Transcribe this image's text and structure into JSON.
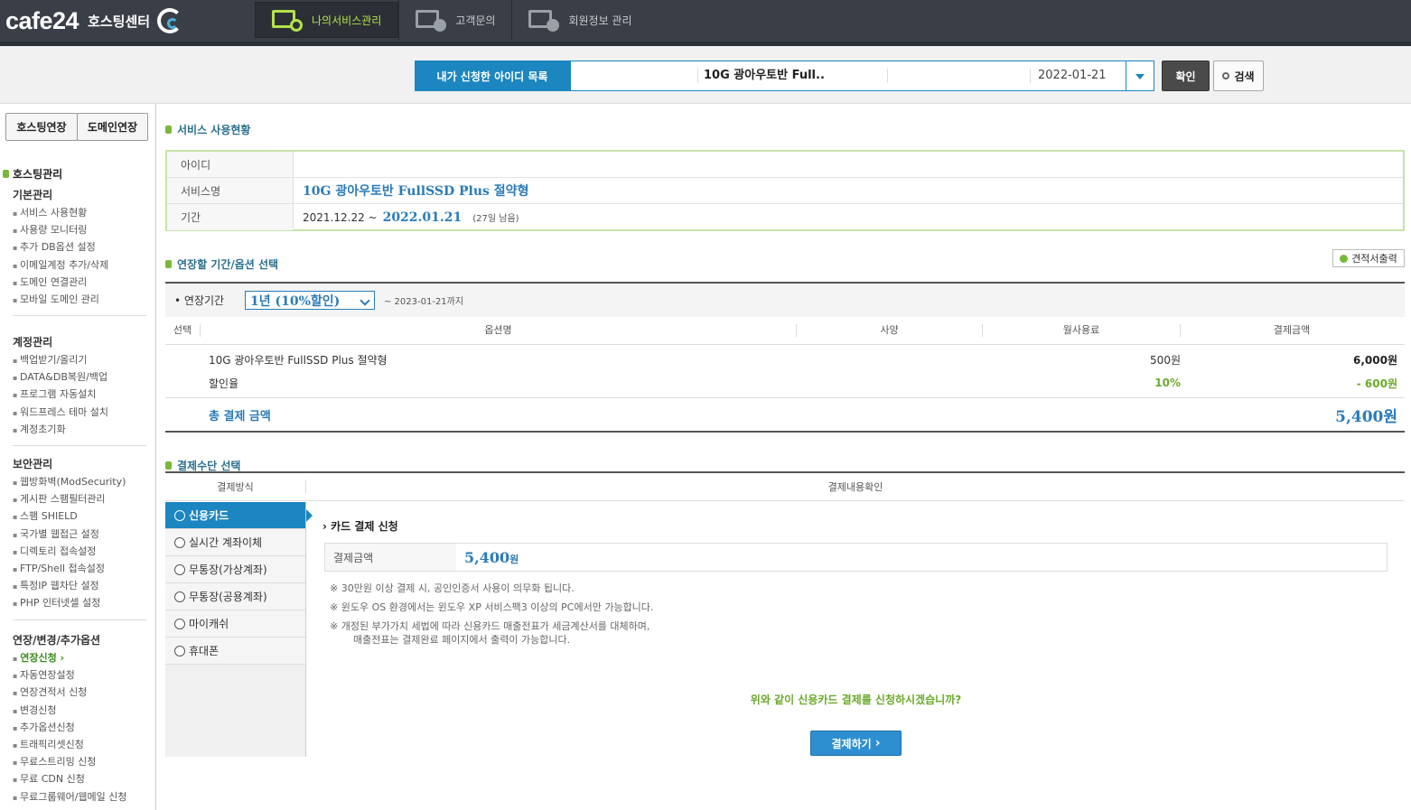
{
  "header": {
    "brand": "cafe24",
    "brand_sub": "호스팅센터",
    "nav": [
      {
        "label": "나의서비스관리",
        "icon": "monitor-gear-icon",
        "active": true
      },
      {
        "label": "고객문의",
        "icon": "monitor-chat-icon",
        "active": false
      },
      {
        "label": "회원정보 관리",
        "icon": "monitor-user-icon",
        "active": false
      }
    ]
  },
  "idbar": {
    "list_label": "내가 신청한 아이디 목록",
    "selected_service": "10G 광아우토반 Full..",
    "selected_date": "2022-01-21",
    "confirm_label": "확인",
    "search_label": "검색"
  },
  "sidebar": {
    "tab_hosting": "호스팅연장",
    "tab_domain": "도메인연장",
    "section_title": "호스팅관리",
    "groups": [
      {
        "title": "기본관리",
        "items": [
          "서비스 사용현황",
          "사용량 모니터링",
          "추가 DB옵션 설정",
          "이메일계정 추가/삭제",
          "도메인 연결관리",
          "모바일 도메인 관리"
        ]
      },
      {
        "title": "계정관리",
        "items": [
          "백업받기/올리기",
          "DATA&DB복원/백업",
          "프로그램 자동설치",
          "워드프레스 테마 설치",
          "계정초기화"
        ]
      },
      {
        "title": "보안관리",
        "items": [
          "웹방화벽(ModSecurity)",
          "게시판 스팸필터관리",
          "스팸 SHIELD",
          "국가별 웹접근 설정",
          "디렉토리 접속설정",
          "FTP/Shell 접속설정",
          "특정IP 웹차단 설정",
          "PHP 인터넷셀 설정"
        ]
      },
      {
        "title": "연장/변경/추가옵션",
        "items": [
          "연장신청",
          "자동연장설정",
          "연장견적서 신청",
          "변경신청",
          "추가옵션신청",
          "트래픽리셋신청",
          "무료스트리밍 신청",
          "무료 CDN 신청",
          "무료그룹웨어/웹메일 신청"
        ]
      }
    ]
  },
  "usage": {
    "title": "서비스 사용현황",
    "id_label": "아이디",
    "id_value": "",
    "service_label": "서비스명",
    "service_value": "10G 광아우토반 FullSSD Plus 절약형",
    "period_label": "기간",
    "period_start": "2021.12.22 ~",
    "period_end": "2022.01.21",
    "period_remain": "(27일 남음)"
  },
  "extend": {
    "title": "연장할 기간/옵션 선택",
    "quote_label": "견적서출력",
    "period_label": "연장기간",
    "period_select": "1년 (10%할인)",
    "period_until": "~ 2023-01-21까지",
    "columns": [
      "선택",
      "옵션명",
      "사양",
      "월사용료",
      "결제금액"
    ],
    "rows": [
      {
        "name": "10G 광아우토반 FullSSD Plus 절약형",
        "monthly": "500원",
        "amount": "6,000원"
      },
      {
        "name": "할인율",
        "monthly": "10%",
        "amount": "- 600원"
      }
    ],
    "total_label": "총 결제 금액",
    "total_value": "5,400원"
  },
  "payment": {
    "title": "결제수단 선택",
    "col_method": "결제방식",
    "col_confirm": "결제내용확인",
    "methods": [
      "신용카드",
      "실시간 계좌이체",
      "무통장(가상계좌)",
      "무통장(공용계좌)",
      "마이캐쉬",
      "휴대폰"
    ],
    "card_title": "카드 결제 신청",
    "amount_label": "결제금액",
    "amount_value": "5,400",
    "amount_unit": "원",
    "notes": [
      "※ 30만원 이상 결제 시, 공인인증서 사용이 의무화 됩니다.",
      "※ 윈도우 OS 환경에서는 윈도우 XP 서비스팩3 이상의 PC에서만 가능합니다.",
      "※ 개정된 부가가치 세법에 따라 신용카드 매출전표가 세금계산서를 대체하며,",
      "매출전표는 결제완료 페이지에서 출력이 가능합니다."
    ],
    "ask": "위와 같이 신용카드 결제를 신청하시겠습니까?",
    "pay_button": "결제하기"
  },
  "colors": {
    "accent_blue": "#1b86c0",
    "accent_green": "#7ab83a",
    "topbar": "#3a3f47"
  }
}
